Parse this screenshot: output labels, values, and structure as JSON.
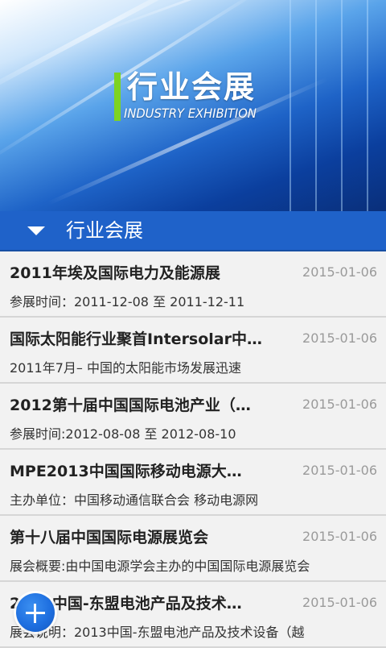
{
  "banner": {
    "title": "行业会展",
    "subtitle": "INDUSTRY EXHIBITION"
  },
  "section": {
    "title": "行业会展"
  },
  "items": [
    {
      "title": "2011年埃及国际电力及能源展",
      "date": "2015-01-06",
      "desc": "参展时间：2011-12-08 至 2011-12-11"
    },
    {
      "title": "国际太阳能行业聚首Intersolar中…",
      "date": "2015-01-06",
      "desc": "2011年7月– 中国的太阳能市场发展迅速"
    },
    {
      "title": "2012第十届中国国际电池产业（…",
      "date": "2015-01-06",
      "desc": "参展时间:2012-08-08 至 2012-08-10"
    },
    {
      "title": "MPE2013中国国际移动电源大…",
      "date": "2015-01-06",
      "desc": "主办单位：中国移动通信联合会 移动电源网"
    },
    {
      "title": "第十八届中国国际电源展览会",
      "date": "2015-01-06",
      "desc": "展会概要:由中国电源学会主办的中国国际电源展览会"
    },
    {
      "title": "2013中国-东盟电池产品及技术…",
      "date": "2015-01-06",
      "desc": "展会说明：2013中国-东盟电池产品及技术设备（越"
    }
  ],
  "colors": {
    "header_blue": "#1f62c9",
    "logo_green": "#7ed321",
    "date_gray": "#9a9a9a"
  },
  "icons": {
    "section_caret": "caret-down-icon",
    "fab": "plus-icon"
  }
}
